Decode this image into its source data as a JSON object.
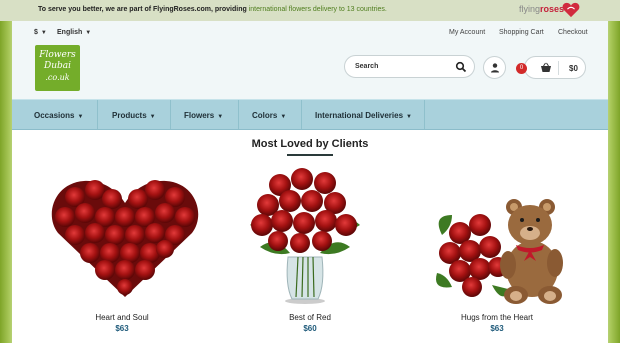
{
  "topbar": {
    "message_prefix": "To serve you better, we are part of FlyingRoses.com, providing",
    "message_highlight": "international flowers delivery to 13 countries.",
    "brand_logo_main": "flying",
    "brand_logo_accent": "roses"
  },
  "header": {
    "currency": "$",
    "language": "English",
    "logo": {
      "line1": "Flowers",
      "line2": "Dubai",
      "line3": ".co.uk"
    },
    "links": {
      "account": "My Account",
      "cart": "Shopping Cart",
      "checkout": "Checkout"
    },
    "search": {
      "placeholder": "Search"
    },
    "cart": {
      "count": "0",
      "total": "$0"
    }
  },
  "nav": {
    "items": [
      {
        "label": "Occasions"
      },
      {
        "label": "Products"
      },
      {
        "label": "Flowers"
      },
      {
        "label": "Colors"
      },
      {
        "label": "International Deliveries"
      }
    ]
  },
  "section": {
    "title": "Most Loved by Clients"
  },
  "products": [
    {
      "name": "Heart and Soul",
      "price": "$63"
    },
    {
      "name": "Best of Red",
      "price": "$60"
    },
    {
      "name": "Hugs from the Heart",
      "price": "$63"
    }
  ],
  "colors": {
    "accent_green": "#74ad2a",
    "nav_blue": "#a9d1dc",
    "price_blue": "#1e5a7a",
    "rose_red": "#b01818"
  }
}
